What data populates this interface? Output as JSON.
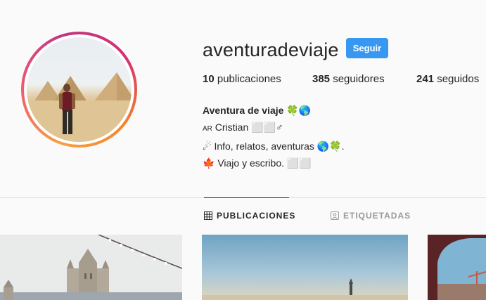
{
  "profile": {
    "username": "aventuradeviaje",
    "follow_label": "Seguir",
    "stats": [
      {
        "value": "10",
        "label": " publicaciones"
      },
      {
        "value": "385",
        "label": " seguidores"
      },
      {
        "value": "241",
        "label": " seguidos"
      }
    ],
    "bio": {
      "name": "Aventura de viaje 🍀🌎",
      "line1_prefix": "AR",
      "line1": " Cristian ⬜⬜♂",
      "line2": "☄ Info, relatos, aventuras 🌎🍀.",
      "line3": "🍁 Viajo y escribo. ⬜⬜"
    }
  },
  "tabs": [
    {
      "label": "PUBLICACIONES",
      "icon": "grid-icon",
      "active": true
    },
    {
      "label": "ETIQUETADAS",
      "icon": "tagged-icon",
      "active": false
    }
  ],
  "colors": {
    "accent": "#3897f0",
    "text": "#262626",
    "muted": "#999999",
    "border": "#dbdbdb"
  }
}
